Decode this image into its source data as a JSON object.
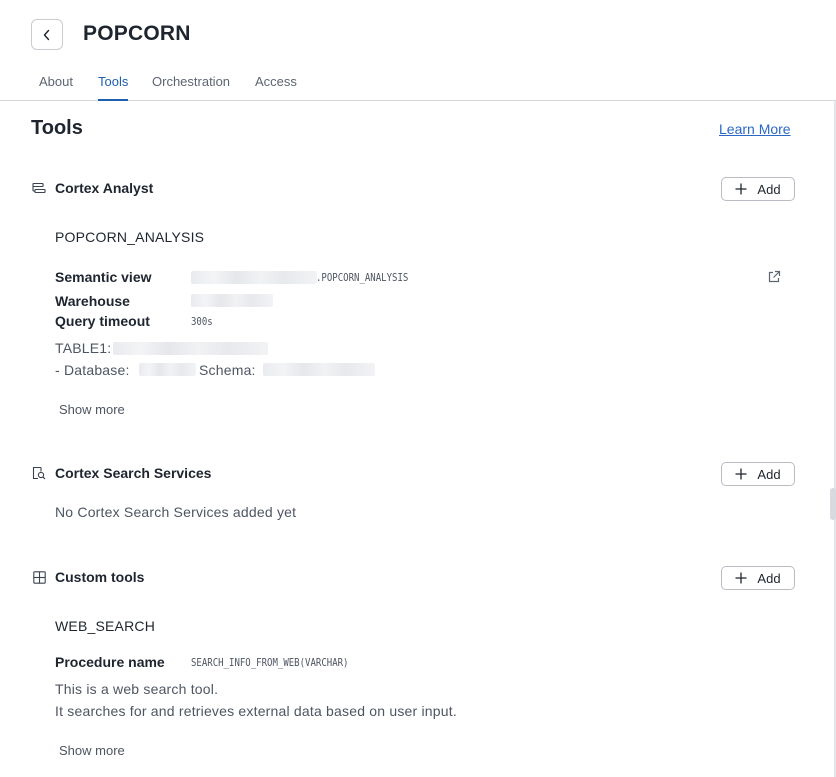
{
  "header": {
    "title": "POPCORN"
  },
  "tabs": [
    {
      "label": "About",
      "active": false
    },
    {
      "label": "Tools",
      "active": true
    },
    {
      "label": "Orchestration",
      "active": false
    },
    {
      "label": "Access",
      "active": false
    }
  ],
  "main": {
    "title": "Tools",
    "learn_more": "Learn More",
    "add_label": "Add",
    "cortex_analyst": {
      "label": "Cortex Analyst",
      "icon": "analyst-icon",
      "item_name": "POPCORN_ANALYSIS",
      "semantic_view_label": "Semantic view",
      "semantic_view_value": ".POPCORN_ANALYSIS",
      "warehouse_label": "Warehouse",
      "query_timeout_label": "Query timeout",
      "query_timeout_value": "300s",
      "table_label": "TABLE1:",
      "database_label": "- Database:",
      "schema_label": "Schema:",
      "show_more": "Show more"
    },
    "cortex_search": {
      "label": "Cortex Search Services",
      "icon": "search-document-icon",
      "empty_text": "No Cortex Search Services added yet"
    },
    "custom_tools": {
      "label": "Custom tools",
      "icon": "grid-icon",
      "item_name": "WEB_SEARCH",
      "procedure_label": "Procedure name",
      "procedure_value": "SEARCH_INFO_FROM_WEB(VARCHAR)",
      "description_line1": "This is a web search tool.",
      "description_line2": "It searches for and retrieves external data based on user input.",
      "show_more": "Show more"
    }
  },
  "colors": {
    "accent": "#1f5fb0",
    "link": "#2a68c4",
    "text": "#1e252f",
    "muted": "#4e5562",
    "border": "#d5d8dd"
  }
}
